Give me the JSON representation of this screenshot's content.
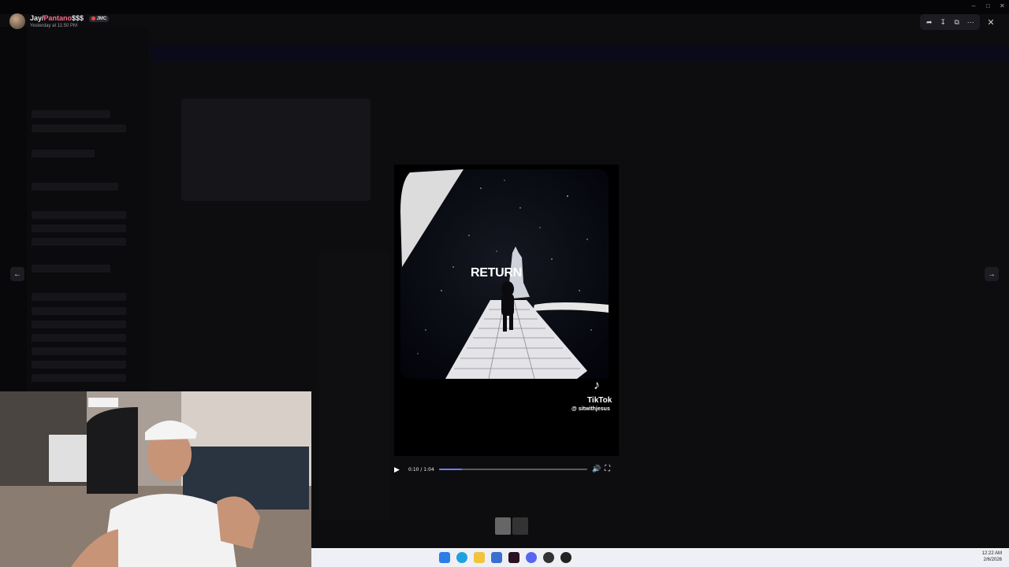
{
  "viewer": {
    "author": {
      "name_part1": "Jay/",
      "name_part2": "Pantano",
      "name_part3": "$$$",
      "tag": "JMC",
      "timestamp": "Yesterday at 11:50 PM"
    },
    "icons": {
      "share": "share-icon",
      "download": "download-icon",
      "open_external": "open-external-icon",
      "more": "more-icon",
      "close": "close-icon",
      "prev": "arrow-left-icon",
      "next": "arrow-right-icon"
    }
  },
  "video": {
    "overlay_text": "RETURN",
    "watermark_brand": "TikTok",
    "watermark_handle": "@ sitwithjesus",
    "time": "0:10 / 1:04",
    "progress": 0.156
  },
  "thumbnails": {
    "count": 2,
    "active_index": 0
  },
  "taskbar": {
    "time": "12:22 AM",
    "date": "2/6/2026",
    "apps": [
      "windows-start-icon",
      "edge-icon",
      "file-explorer-icon",
      "store-icon",
      "app-icon",
      "discord-icon",
      "app2-icon",
      "media-icon"
    ]
  },
  "colors": {
    "accent_progress": "#6f7bf7",
    "username_highlight": "#ff6b8b"
  }
}
